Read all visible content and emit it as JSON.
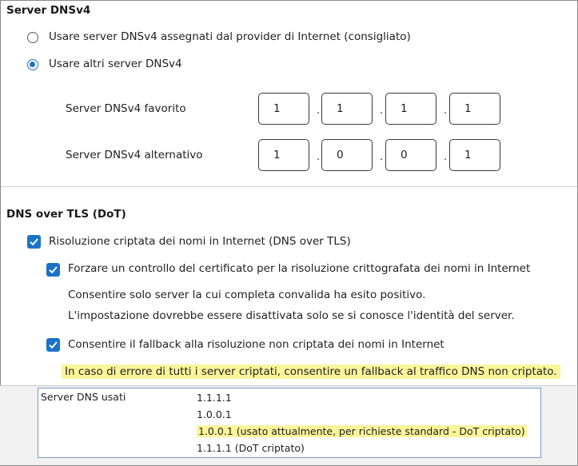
{
  "dnsv4": {
    "title": "Server DNSv4",
    "option_auto": "Usare server DNSv4 assegnati dal provider di Internet (consigliato)",
    "option_manual": "Usare altri server DNSv4",
    "selected": "option_manual",
    "preferred_label": "Server DNSv4 favorito",
    "preferred": [
      "1",
      "1",
      "1",
      "1"
    ],
    "alternate_label": "Server DNSv4 alternativo",
    "alternate": [
      "1",
      "0",
      "0",
      "1"
    ]
  },
  "dot": {
    "title": "DNS over TLS (DoT)",
    "encrypt_label": "Risoluzione criptata dei nomi in Internet (DNS over TLS)",
    "encrypt_checked": true,
    "cert_label": "Forzare un controllo del certificato per la risoluzione crittografata dei nomi in Internet",
    "cert_checked": true,
    "cert_help_1": "Consentire solo server la cui completa convalida ha esito positivo.",
    "cert_help_2": "L'impostazione dovrebbe essere disattivata solo se si conosce l'identità del server.",
    "fallback_label": "Consentire il fallback alla risoluzione non criptata dei nomi in Internet",
    "fallback_checked": true,
    "fallback_help": "In caso di errore di tutti i server criptati, consentire un fallback al traffico DNS non criptato."
  },
  "dns_used": {
    "label": "Server DNS usati",
    "values": [
      "1.1.1.1",
      "1.0.0.1",
      "1.0.0.1 (usato attualmente, per richieste standard - DoT criptato)",
      "1.1.1.1 (DoT criptato)"
    ]
  },
  "colors": {
    "accent": "#1a73c7",
    "highlight": "#fbf59a"
  }
}
